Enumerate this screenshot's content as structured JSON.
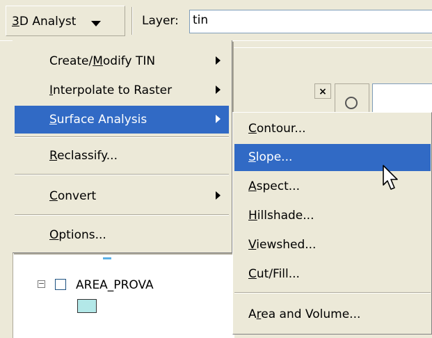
{
  "toolbar": {
    "menu_label_first": "3",
    "menu_label_rest": "D Analyst",
    "layer_label": "Layer:",
    "layer_value": "tin"
  },
  "main_menu": {
    "items": [
      {
        "pre": "Create/",
        "key": "M",
        "post": "odify TIN",
        "submenu": true,
        "selected": false
      },
      {
        "pre": "",
        "key": "I",
        "post": "nterpolate to Raster",
        "submenu": true,
        "selected": false
      },
      {
        "pre": "",
        "key": "S",
        "post": "urface Analysis",
        "submenu": true,
        "selected": true
      },
      {
        "pre": "",
        "key": "R",
        "post": "eclassify...",
        "submenu": false,
        "selected": false
      },
      {
        "pre": "",
        "key": "C",
        "post": "onvert",
        "submenu": true,
        "selected": false
      },
      {
        "pre": "",
        "key": "O",
        "post": "ptions...",
        "submenu": false,
        "selected": false
      }
    ]
  },
  "surface_menu": {
    "items": [
      {
        "pre": "",
        "key": "C",
        "post": "ontour...",
        "selected": false
      },
      {
        "pre": "",
        "key": "S",
        "post": "lope...",
        "selected": true
      },
      {
        "pre": "",
        "key": "A",
        "post": "spect...",
        "selected": false
      },
      {
        "pre": "",
        "key": "H",
        "post": "illshade...",
        "selected": false
      },
      {
        "pre": "",
        "key": "V",
        "post": "iewshed...",
        "selected": false
      },
      {
        "pre": "",
        "key": "C",
        "post": "ut/Fill...",
        "selected": false
      },
      {
        "pre": "A",
        "key": "r",
        "post": "ea and Volume...",
        "selected": false
      }
    ]
  },
  "toc": {
    "layer_name": "AREA_PROVA",
    "expand_symbol": "−",
    "swatch_color": "#b3e8e8"
  },
  "background": {
    "close_glyph": "×"
  },
  "colors": {
    "highlight": "#316ac5",
    "menu_bg": "#ece9d8"
  }
}
